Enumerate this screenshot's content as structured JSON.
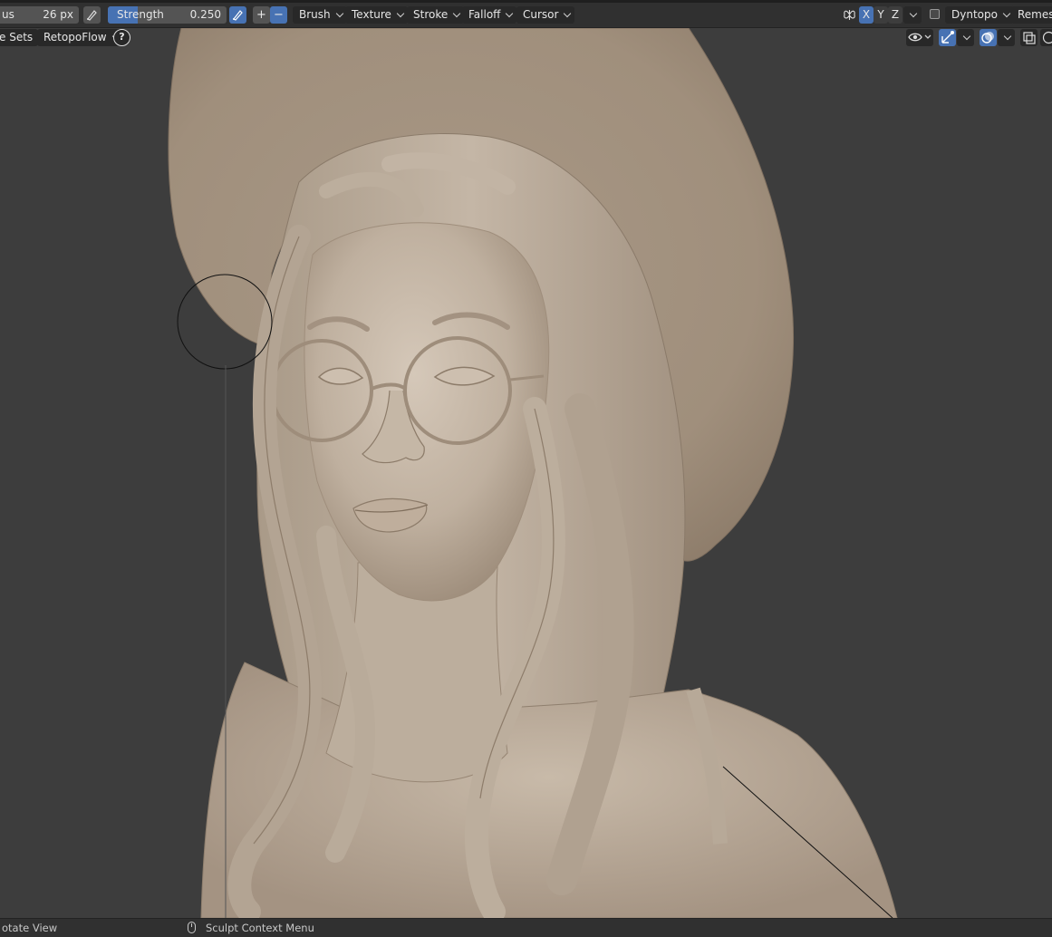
{
  "header": {
    "radius": {
      "label": "us",
      "value": "26 px"
    },
    "strength": {
      "label": "Strength",
      "value": "0.250",
      "fill_fraction": 0.25
    },
    "plus_label": "+",
    "minus_label": "−",
    "menus": [
      "Brush",
      "Texture",
      "Stroke",
      "Falloff",
      "Cursor"
    ],
    "axes": [
      "X",
      "Y",
      "Z"
    ],
    "dyntopo_label": "Dyntopo",
    "remesh_label": "Remesh",
    "face_sets_label": "e Sets",
    "retopoflow_label": "RetopoFlow",
    "help_label": "?"
  },
  "status": {
    "left_hint": "otate View",
    "right_hint": "Sculpt Context Menu"
  },
  "colors": {
    "accent_blue": "#4772b3",
    "viewport_bg": "#3d3d3d",
    "clay": "#b5a594"
  }
}
